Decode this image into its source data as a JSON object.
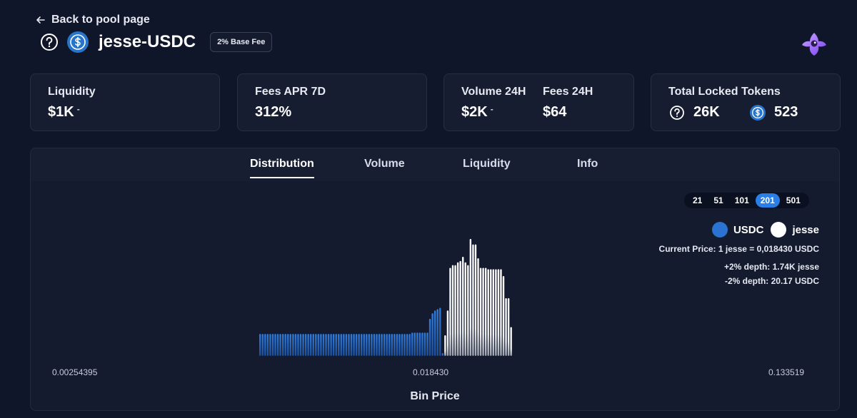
{
  "nav": {
    "back_label": "Back to pool page"
  },
  "pool": {
    "name": "jesse-USDC",
    "fee_badge": "2% Base Fee"
  },
  "stats": {
    "liquidity": {
      "label": "Liquidity",
      "value": "$1K",
      "dash": "-"
    },
    "fees_apr": {
      "label": "Fees APR 7D",
      "value": "312%"
    },
    "volume": {
      "label": "Volume 24H",
      "value": "$2K",
      "dash": "-"
    },
    "fees": {
      "label": "Fees 24H",
      "value": "$64"
    },
    "locked": {
      "label": "Total Locked Tokens",
      "token_a_value": "26K",
      "token_b_value": "523"
    }
  },
  "tabs": [
    {
      "label": "Distribution",
      "active": true
    },
    {
      "label": "Volume",
      "active": false
    },
    {
      "label": "Liquidity",
      "active": false
    },
    {
      "label": "Info",
      "active": false
    }
  ],
  "range_options": [
    {
      "label": "21",
      "active": false
    },
    {
      "label": "51",
      "active": false
    },
    {
      "label": "101",
      "active": false
    },
    {
      "label": "201",
      "active": true
    },
    {
      "label": "501",
      "active": false
    }
  ],
  "legend": {
    "quote": "USDC",
    "base": "jesse"
  },
  "price_info": {
    "current_price": "Current Price: 1 jesse = 0,018430 USDC",
    "plus_depth": "+2% depth: 1.74K jesse",
    "minus_depth": "-2% depth: 20.17 USDC"
  },
  "colors": {
    "accent": "#2a7fe6",
    "usdc": "#2a73d2",
    "jesse": "#ffffff",
    "background": "#101629"
  },
  "icons": {
    "back": "arrow-left-icon",
    "unknown_token": "question-circle-icon",
    "usdc": "usdc-icon",
    "logo": "app-logo-icon"
  },
  "chart_data": {
    "type": "bar",
    "xlabel": "Bin Price",
    "x_ticks": [
      "0.00254395",
      "0.018430",
      "0.133519"
    ],
    "ylim": [
      0,
      100
    ],
    "series": [
      {
        "name": "USDC",
        "values": [
          16,
          16,
          16,
          16,
          16,
          16,
          16,
          16,
          16,
          16,
          16,
          16,
          16,
          16,
          16,
          16,
          16,
          16,
          16,
          16,
          16,
          16,
          16,
          16,
          16,
          16,
          16,
          16,
          16,
          16,
          16,
          16,
          16,
          16,
          16,
          16,
          16,
          16,
          16,
          16,
          16,
          16,
          16,
          16,
          16,
          16,
          16,
          16,
          16,
          16,
          16,
          16,
          16,
          16,
          16,
          16,
          16,
          16,
          16,
          16,
          17,
          17,
          17,
          17,
          17,
          17,
          17,
          27,
          31,
          33,
          34,
          35,
          2
        ]
      },
      {
        "name": "jesse",
        "values": [
          15,
          33,
          64,
          66,
          66,
          68,
          69,
          72,
          68,
          66,
          85,
          81,
          81,
          71,
          64,
          64,
          64,
          63,
          63,
          63,
          63,
          63,
          63,
          58,
          42,
          42,
          21
        ]
      }
    ]
  }
}
